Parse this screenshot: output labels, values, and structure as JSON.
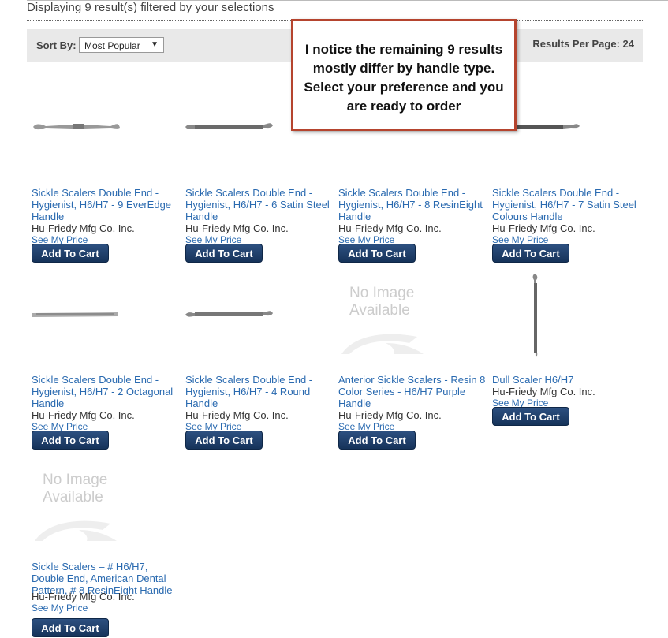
{
  "summary": "Displaying 9 result(s) filtered by your selections",
  "sort": {
    "label": "Sort By:",
    "selected": "Most Popular"
  },
  "per_page": {
    "label": "Results Per Page:",
    "value": "24"
  },
  "callout": "I notice the remaining 9 results mostly differ by handle type.  Select your preference and you are ready to order",
  "no_image": {
    "line1": "No Image",
    "line2": "Available"
  },
  "products": [
    {
      "title": "Sickle Scalers Double End - Hygienist, H6/H7 - 9 EverEdge Handle",
      "brand": "Hu-Friedy Mfg Co. Inc.",
      "price": "See My Price",
      "cart": "Add To Cart"
    },
    {
      "title": "Sickle Scalers Double End - Hygienist, H6/H7 - 6 Satin Steel Handle",
      "brand": "Hu-Friedy Mfg Co. Inc.",
      "price": "See My Price",
      "cart": "Add To Cart"
    },
    {
      "title": "Sickle Scalers Double End - Hygienist, H6/H7 - 8 ResinEight Handle",
      "brand": "Hu-Friedy Mfg Co. Inc.",
      "price": "See My Price",
      "cart": "Add To Cart"
    },
    {
      "title": "Sickle Scalers Double End - Hygienist, H6/H7 - 7 Satin Steel Colours Handle",
      "brand": "Hu-Friedy Mfg Co. Inc.",
      "price": "See My Price",
      "cart": "Add To Cart"
    },
    {
      "title": "Sickle Scalers Double End - Hygienist, H6/H7 - 2 Octagonal Handle",
      "brand": "Hu-Friedy Mfg Co. Inc.",
      "price": "See My Price",
      "cart": "Add To Cart"
    },
    {
      "title": "Sickle Scalers Double End - Hygienist, H6/H7 - 4 Round Handle",
      "brand": "Hu-Friedy Mfg Co. Inc.",
      "price": "See My Price",
      "cart": "Add To Cart"
    },
    {
      "title": "Anterior Sickle Scalers - Resin 8 Color Series - H6/H7 Purple Handle",
      "brand": "Hu-Friedy Mfg Co. Inc.",
      "price": "See My Price",
      "cart": "Add To Cart"
    },
    {
      "title": "Dull Scaler H6/H7",
      "brand": "Hu-Friedy Mfg Co. Inc.",
      "price": "See My Price",
      "cart": "Add To Cart"
    },
    {
      "title": "Sickle Scalers – # H6/H7, Double End, American Dental Pattern, # 8 ResinEight Handle",
      "brand": "Hu-Friedy Mfg Co. Inc.",
      "price": "See My Price",
      "cart": "Add To Cart"
    }
  ]
}
